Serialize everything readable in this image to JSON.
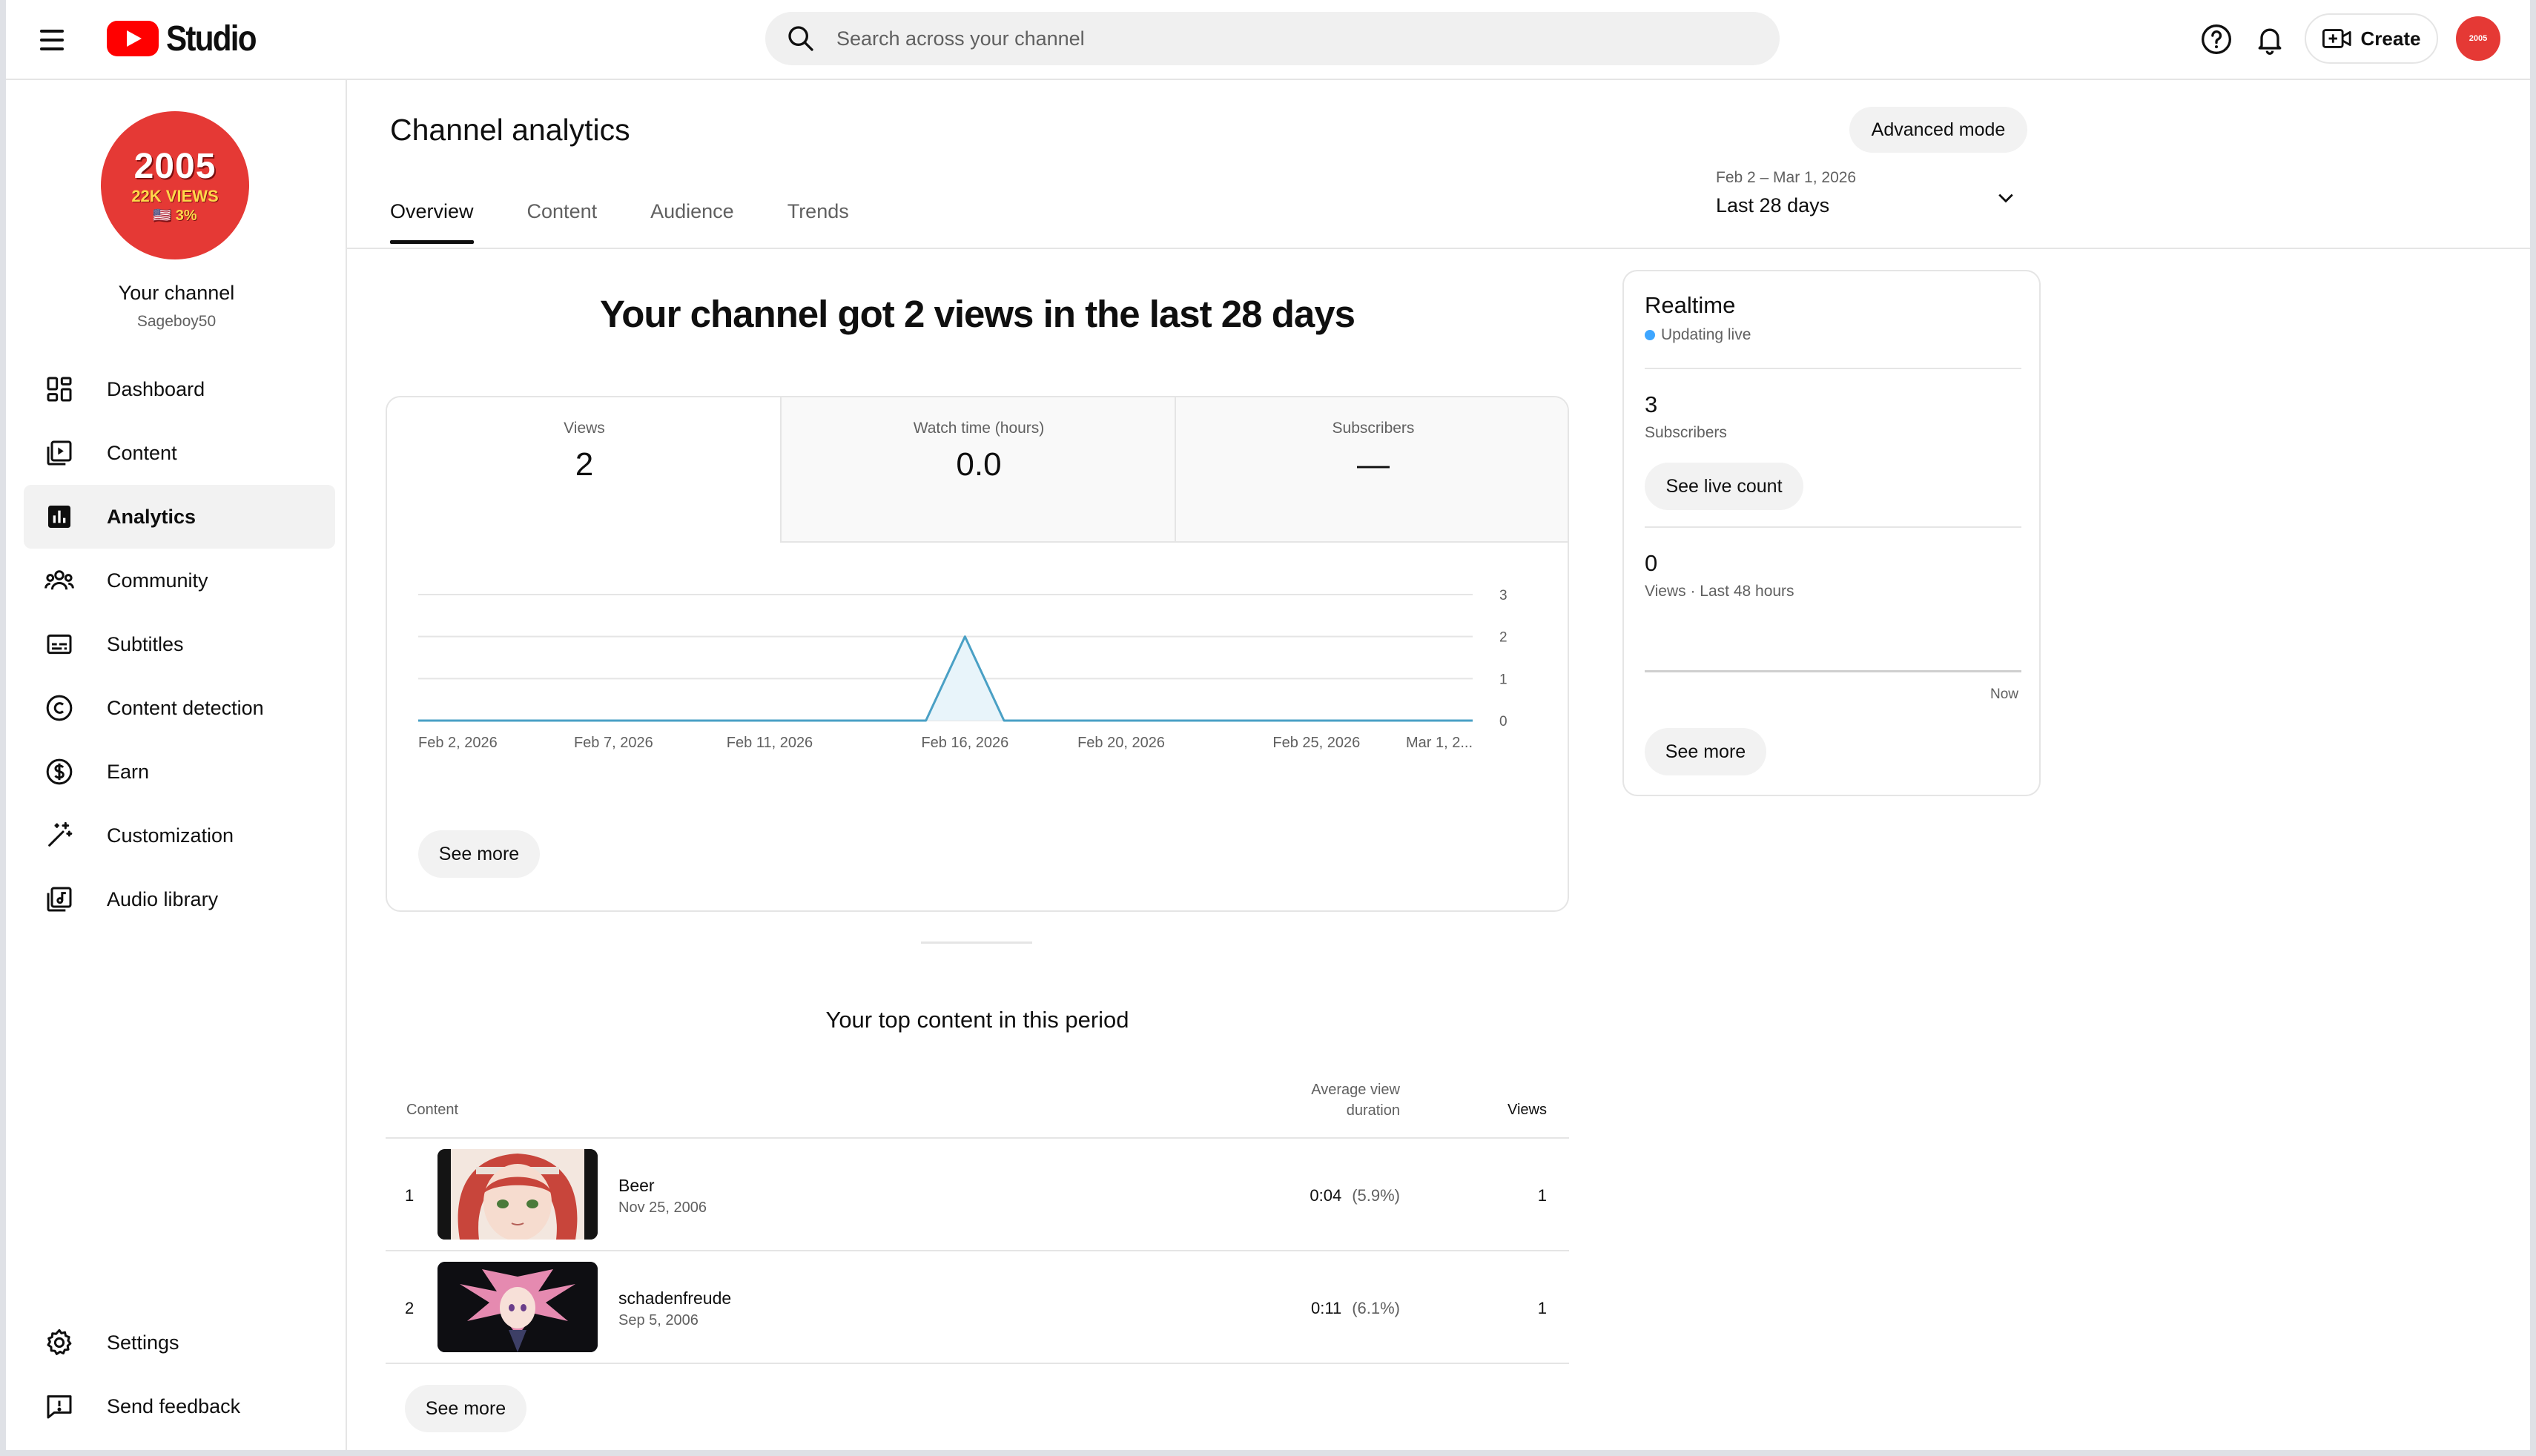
{
  "header": {
    "logo_text": "Studio",
    "search_placeholder": "Search across your channel",
    "create_label": "Create",
    "avatar_text": "2005"
  },
  "sidebar": {
    "avatar": {
      "line1": "2005",
      "line2": "22K VIEWS",
      "line3": "🇺🇸 3%"
    },
    "channel_title": "Your channel",
    "channel_handle": "Sageboy50",
    "items": [
      {
        "label": "Dashboard",
        "icon": "dashboard-icon"
      },
      {
        "label": "Content",
        "icon": "content-icon"
      },
      {
        "label": "Analytics",
        "icon": "analytics-icon",
        "active": true
      },
      {
        "label": "Community",
        "icon": "community-icon"
      },
      {
        "label": "Subtitles",
        "icon": "subtitles-icon"
      },
      {
        "label": "Content detection",
        "icon": "copyright-icon"
      },
      {
        "label": "Earn",
        "icon": "dollar-icon"
      },
      {
        "label": "Customization",
        "icon": "magic-wand-icon"
      },
      {
        "label": "Audio library",
        "icon": "audio-library-icon"
      }
    ],
    "bottom": [
      {
        "label": "Settings",
        "icon": "gear-icon"
      },
      {
        "label": "Send feedback",
        "icon": "feedback-icon"
      }
    ]
  },
  "main": {
    "title": "Channel analytics",
    "advanced_mode": "Advanced mode",
    "tabs": [
      "Overview",
      "Content",
      "Audience",
      "Trends"
    ],
    "date_range": {
      "sub": "Feb 2 – Mar 1, 2026",
      "main": "Last 28 days"
    },
    "headline": "Your channel got 2 views in the last 28 days",
    "metrics": [
      {
        "label": "Views",
        "value": "2"
      },
      {
        "label": "Watch time (hours)",
        "value": "0.0"
      },
      {
        "label": "Subscribers",
        "value": "—"
      }
    ],
    "see_more": "See more",
    "top_content": {
      "title": "Your top content in this period",
      "col_content": "Content",
      "col_avd": "Average view duration",
      "col_views": "Views",
      "rows": [
        {
          "rank": "1",
          "title": "Beer",
          "date": "Nov 25, 2006",
          "avd": "0:04",
          "pct": "(5.9%)",
          "views": "1"
        },
        {
          "rank": "2",
          "title": "schadenfreude",
          "date": "Sep 5, 2006",
          "avd": "0:11",
          "pct": "(6.1%)",
          "views": "1"
        }
      ],
      "see_more": "See more"
    }
  },
  "chart_data": {
    "type": "area",
    "series": [
      {
        "x": [
          "Feb 2, 2026",
          "Feb 3, 2026",
          "Feb 4, 2026",
          "Feb 5, 2026",
          "Feb 6, 2026",
          "Feb 7, 2026",
          "Feb 8, 2026",
          "Feb 9, 2026",
          "Feb 10, 2026",
          "Feb 11, 2026",
          "Feb 12, 2026",
          "Feb 13, 2026",
          "Feb 14, 2026",
          "Feb 15, 2026",
          "Feb 16, 2026",
          "Feb 17, 2026",
          "Feb 18, 2026",
          "Feb 19, 2026",
          "Feb 20, 2026",
          "Feb 21, 2026",
          "Feb 22, 2026",
          "Feb 23, 2026",
          "Feb 24, 2026",
          "Feb 25, 2026",
          "Feb 26, 2026",
          "Feb 27, 2026",
          "Feb 28, 2026",
          "Mar 1, 2026"
        ],
        "values": [
          0,
          0,
          0,
          0,
          0,
          0,
          0,
          0,
          0,
          0,
          0,
          0,
          0,
          0,
          2,
          0,
          0,
          0,
          0,
          0,
          0,
          0,
          0,
          0,
          0,
          0,
          0,
          0
        ]
      }
    ],
    "x_tick_labels": [
      "Feb 2, 2026",
      "Feb 7, 2026",
      "Feb 11, 2026",
      "Feb 16, 2026",
      "Feb 20, 2026",
      "Feb 25, 2026",
      "Mar 1, 2..."
    ],
    "x_tick_days": [
      0,
      5,
      9,
      14,
      18,
      23,
      27
    ],
    "y_ticks": [
      0,
      1,
      2,
      3
    ],
    "ylim": [
      0,
      3
    ],
    "grid": true,
    "line_color": "#4aa0c5",
    "fill_color": "#e8f4fa"
  },
  "realtime": {
    "title": "Realtime",
    "live": "Updating live",
    "subs_value": "3",
    "subs_label": "Subscribers",
    "live_count_btn": "See live count",
    "views_value": "0",
    "views_label": "Views · Last 48 hours",
    "now_label": "Now",
    "see_more": "See more"
  }
}
